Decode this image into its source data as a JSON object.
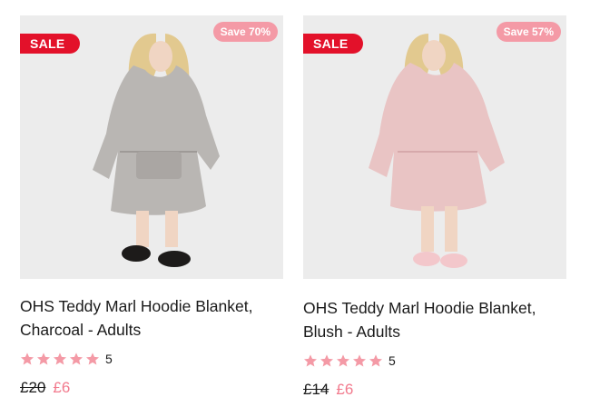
{
  "colors": {
    "sale_badge": "#e3112a",
    "save_badge": "#f49aa6",
    "star": "#f49aa6",
    "sale_price": "#f27a8d",
    "image_bg": "#ececec"
  },
  "products": [
    {
      "sale_label": "SALE",
      "save_label": "Save 70%",
      "title_line1": "OHS Teddy Marl Hoodie Blanket,",
      "title_line2": "Charcoal - Adults",
      "rating": 5,
      "review_count": "5",
      "old_price": "£20",
      "new_price": "£6",
      "garment_color": "#b9b6b3"
    },
    {
      "sale_label": "SALE",
      "save_label": "Save 57%",
      "title_line1": "OHS Teddy Marl Hoodie Blanket,",
      "title_line2": "Blush - Adults",
      "rating": 5,
      "review_count": "5",
      "old_price": "£14",
      "new_price": "£6",
      "garment_color": "#e9c4c4"
    }
  ]
}
